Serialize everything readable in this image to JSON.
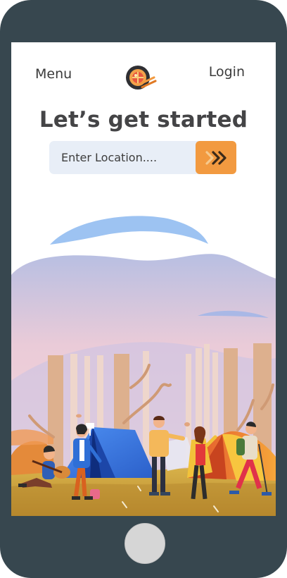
{
  "header": {
    "menu_label": "Menu",
    "login_label": "Login"
  },
  "hero": {
    "title": "Let’s get started"
  },
  "search": {
    "placeholder": "Enter Location....",
    "value": ""
  },
  "icons": {
    "logo": "food-plate-logo-icon",
    "submit": "double-chevron-right-icon"
  },
  "colors": {
    "frame": "#37474f",
    "accent": "#f29a40",
    "search_bg": "#e8eef7",
    "title": "#444446"
  }
}
